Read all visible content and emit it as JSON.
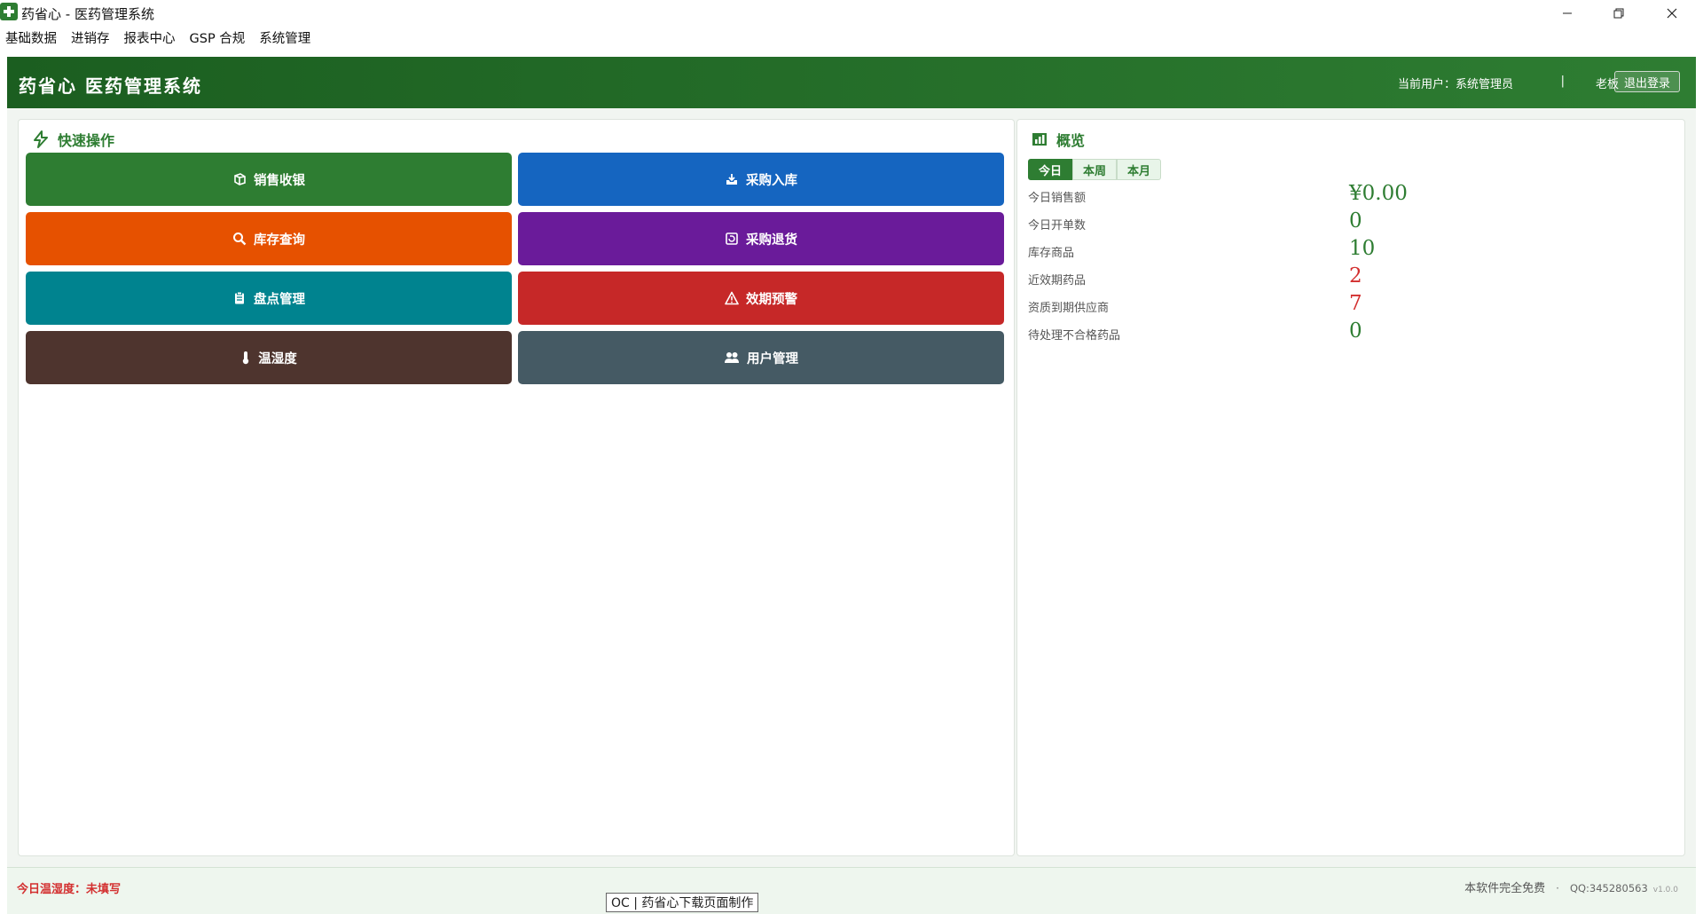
{
  "window": {
    "title": "药省心 - 医药管理系统",
    "controls": [
      "minimize",
      "restore",
      "close"
    ]
  },
  "menubar": {
    "items": [
      "基础数据",
      "进销存",
      "报表中心",
      "GSP 合规",
      "系统管理"
    ]
  },
  "header": {
    "title": "药省心 医药管理系统",
    "current_user": "当前用户：系统管理员",
    "separator": "|",
    "role": "老板",
    "logout_label": "退出登录"
  },
  "quick_ops": {
    "title": "快速操作",
    "buttons": [
      {
        "label": "销售收银",
        "icon": "cube-icon",
        "color": "#2e7d32"
      },
      {
        "label": "采购入库",
        "icon": "inbox-download-icon",
        "color": "#1565c0"
      },
      {
        "label": "库存查询",
        "icon": "search-icon",
        "color": "#e65100"
      },
      {
        "label": "采购退货",
        "icon": "return-box-icon",
        "color": "#6a1b9a"
      },
      {
        "label": "盘点管理",
        "icon": "clipboard-icon",
        "color": "#00838f"
      },
      {
        "label": "效期预警",
        "icon": "warning-icon",
        "color": "#c62828"
      },
      {
        "label": "温湿度",
        "icon": "thermometer-icon",
        "color": "#4e342e"
      },
      {
        "label": "用户管理",
        "icon": "users-icon",
        "color": "#455a64"
      }
    ]
  },
  "overview": {
    "title": "概览",
    "tabs": [
      "今日",
      "本周",
      "本月"
    ],
    "active_tab": "今日",
    "stats": [
      {
        "label": "今日销售额",
        "value": "¥0.00",
        "color": "#2e7d32"
      },
      {
        "label": "今日开单数",
        "value": "0",
        "color": "#2e7d32"
      },
      {
        "label": "库存商品",
        "value": "10",
        "color": "#2e7d32"
      },
      {
        "label": "近效期药品",
        "value": "2",
        "color": "#d32f2f"
      },
      {
        "label": "资质到期供应商",
        "value": "7",
        "color": "#d32f2f"
      },
      {
        "label": "待处理不合格药品",
        "value": "0",
        "color": "#2e7d32"
      }
    ]
  },
  "footer": {
    "temp_status": "今日温湿度：未填写",
    "free_note": "本软件完全免费",
    "dot": "·",
    "qq": "QQ:345280563",
    "version": "v1.0.0"
  },
  "overlay_tag": "OC | 药省心下载页面制作"
}
